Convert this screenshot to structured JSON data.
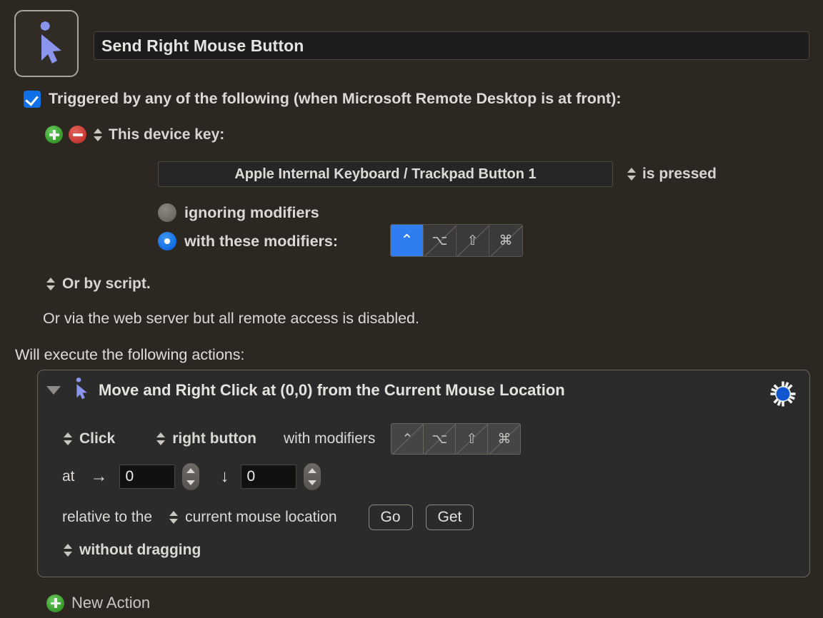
{
  "header": {
    "macro_icon": "mouse-click-cursor-icon",
    "title_value": "Send Right Mouse Button"
  },
  "trigger": {
    "checkbox_checked": true,
    "checkbox_label": "Triggered by any of the following (when Microsoft Remote Desktop is at front):",
    "add_button": "add-trigger",
    "remove_button": "remove-trigger",
    "trigger_type": "This device key:",
    "device_value": "Apple Internal Keyboard / Trackpad Button 1",
    "condition": "is pressed",
    "radio_ignoring_label": "ignoring modifiers",
    "radio_with_label": "with these modifiers:",
    "radio_selected": "with these modifiers",
    "modifiers": [
      {
        "name": "control",
        "glyph": "⌃",
        "selected": true
      },
      {
        "name": "option",
        "glyph": "⌥",
        "selected": false
      },
      {
        "name": "shift",
        "glyph": "⇧",
        "selected": false
      },
      {
        "name": "command",
        "glyph": "⌘",
        "selected": false
      }
    ],
    "script_label": "Or by script.",
    "webserver_label": "Or via the web server but all remote access is disabled."
  },
  "actions_section": {
    "heading": "Will execute the following actions:",
    "new_action_label": "New Action"
  },
  "action": {
    "title": "Move and Right Click at (0,0) from the Current Mouse Location",
    "icon": "mouse-click-cursor-icon",
    "gear": "gear-icon",
    "expanded": true,
    "click_mode": "Click",
    "button_mode": "right button",
    "with_modifiers_label": "with modifiers",
    "modifiers": [
      {
        "name": "control",
        "glyph": "⌃",
        "selected": false
      },
      {
        "name": "option",
        "glyph": "⌥",
        "selected": false
      },
      {
        "name": "shift",
        "glyph": "⇧",
        "selected": false
      },
      {
        "name": "command",
        "glyph": "⌘",
        "selected": false
      }
    ],
    "at_label": "at",
    "x_arrow": "→",
    "x_value": "0",
    "y_arrow": "↓",
    "y_value": "0",
    "relative_label": "relative to the",
    "relative_value": "current mouse location",
    "go_button": "Go",
    "get_button": "Get",
    "drag_mode": "without dragging"
  },
  "colors": {
    "page_bg": "#2c2721",
    "action_bg": "#2b2b2b",
    "accent_blue": "#2f7df0",
    "checkbox_blue": "#1070e8",
    "add_green": "#3ba02f",
    "remove_red": "#c93c34",
    "cursor_icon": "#8b95ee",
    "text": "#dcd9d5"
  }
}
